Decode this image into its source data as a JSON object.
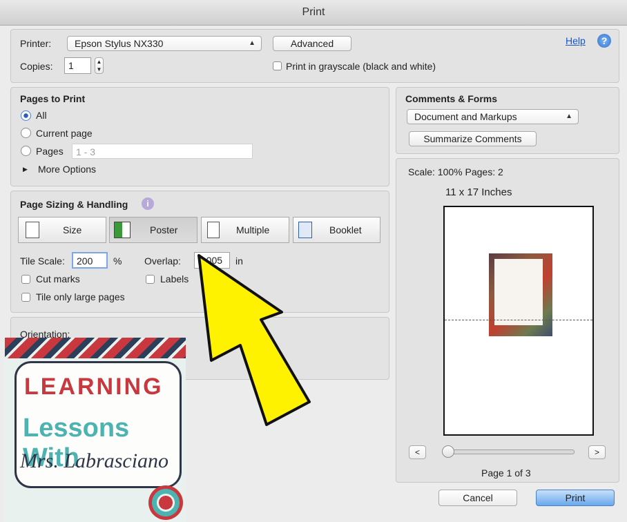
{
  "window": {
    "title": "Print"
  },
  "printer": {
    "label": "Printer:",
    "value": "Epson Stylus NX330"
  },
  "advanced_button": "Advanced",
  "help_link": "Help",
  "copies": {
    "label": "Copies:",
    "value": "1"
  },
  "grayscale": {
    "label": "Print in grayscale (black and white)",
    "checked": false
  },
  "pages_to_print": {
    "title": "Pages to Print",
    "options": [
      {
        "label": "All",
        "selected": true
      },
      {
        "label": "Current page",
        "selected": false
      },
      {
        "label": "Pages",
        "selected": false
      }
    ],
    "pages_placeholder": "1 - 3",
    "more_options": "More Options"
  },
  "sizing": {
    "title": "Page Sizing & Handling",
    "tabs": [
      {
        "label": "Size",
        "selected": false
      },
      {
        "label": "Poster",
        "selected": true
      },
      {
        "label": "Multiple",
        "selected": false
      },
      {
        "label": "Booklet",
        "selected": false
      }
    ],
    "tile_scale_label": "Tile Scale:",
    "tile_scale_value": "200",
    "tile_scale_unit": "%",
    "overlap_label": "Overlap:",
    "overlap_value": "0.005",
    "overlap_unit": "in",
    "cut_marks": "Cut marks",
    "labels": "Labels",
    "tile_large": "Tile only large pages"
  },
  "orientation": {
    "label": "Orientation:"
  },
  "comments": {
    "title": "Comments & Forms",
    "select_value": "Document and Markups",
    "summarize_button": "Summarize Comments"
  },
  "preview": {
    "scale_text": "Scale: 100% Pages: 2",
    "paper_size": "11 x 17 Inches",
    "prev": "<",
    "next": ">",
    "page_indicator": "Page 1 of 3",
    "slider_value": 0
  },
  "footer": {
    "cancel": "Cancel",
    "print": "Print"
  },
  "overlay": {
    "logo_text": [
      "LEARNING",
      "Lessons With",
      "Mrs. Labrasciano"
    ],
    "arrow_color": "#fff200"
  },
  "colors": {
    "accent": "#4a8fe0",
    "help_link": "#1a55c6"
  }
}
